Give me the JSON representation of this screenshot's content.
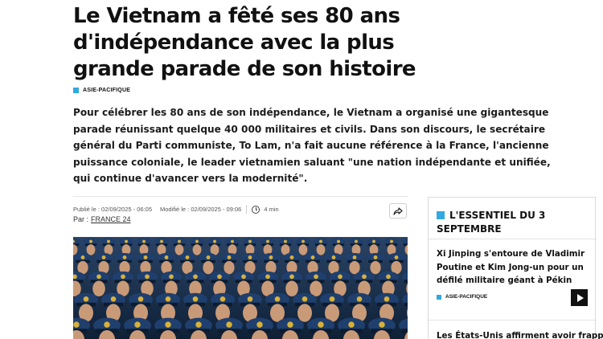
{
  "article": {
    "headline_lines": [
      "Le Vietnam a fêté ses 80 ans",
      "d'indépendance avec la plus",
      "grande parade de son histoire"
    ],
    "category": "ASIE-PACIFIQUE",
    "lede_lines": [
      "Pour célébrer les 80 ans de son indépendance, le Vietnam a organisé une gigantesque",
      "parade réunissant quelque 40 000 militaires et civils. Dans son discours, le secrétaire",
      "général du Parti communiste, To Lam, n'a fait aucune référence à la France, l'ancienne",
      "puissance coloniale, le leader vietnamien saluant \"une nation indépendante et unifiée,",
      "qui continue d'avancer vers la modernité\"."
    ],
    "published": "Publié le : 02/09/2025 - 06:05",
    "modified": "Modifié le : 02/09/2025 - 09:06",
    "read_time": "4 min",
    "byline_prefix": "Par :",
    "byline_author": "FRANCE 24"
  },
  "sidebar": {
    "title": "L'ESSENTIEL DU 3 SEPTEMBRE",
    "item1_title_lines": [
      "Xi Jinping s'entoure de Vladimir",
      "Poutine et Kim Jong-un pour un",
      "défilé militaire géant à Pékin"
    ],
    "item1_category": "ASIE-PACIFIQUE",
    "item2_title": "Les États-Unis affirment avoir frappé"
  },
  "icons": {
    "share": "share-icon",
    "clock": "clock-icon",
    "play": "play-icon"
  },
  "colors": {
    "accent": "#31a8e0",
    "text": "#111111"
  }
}
